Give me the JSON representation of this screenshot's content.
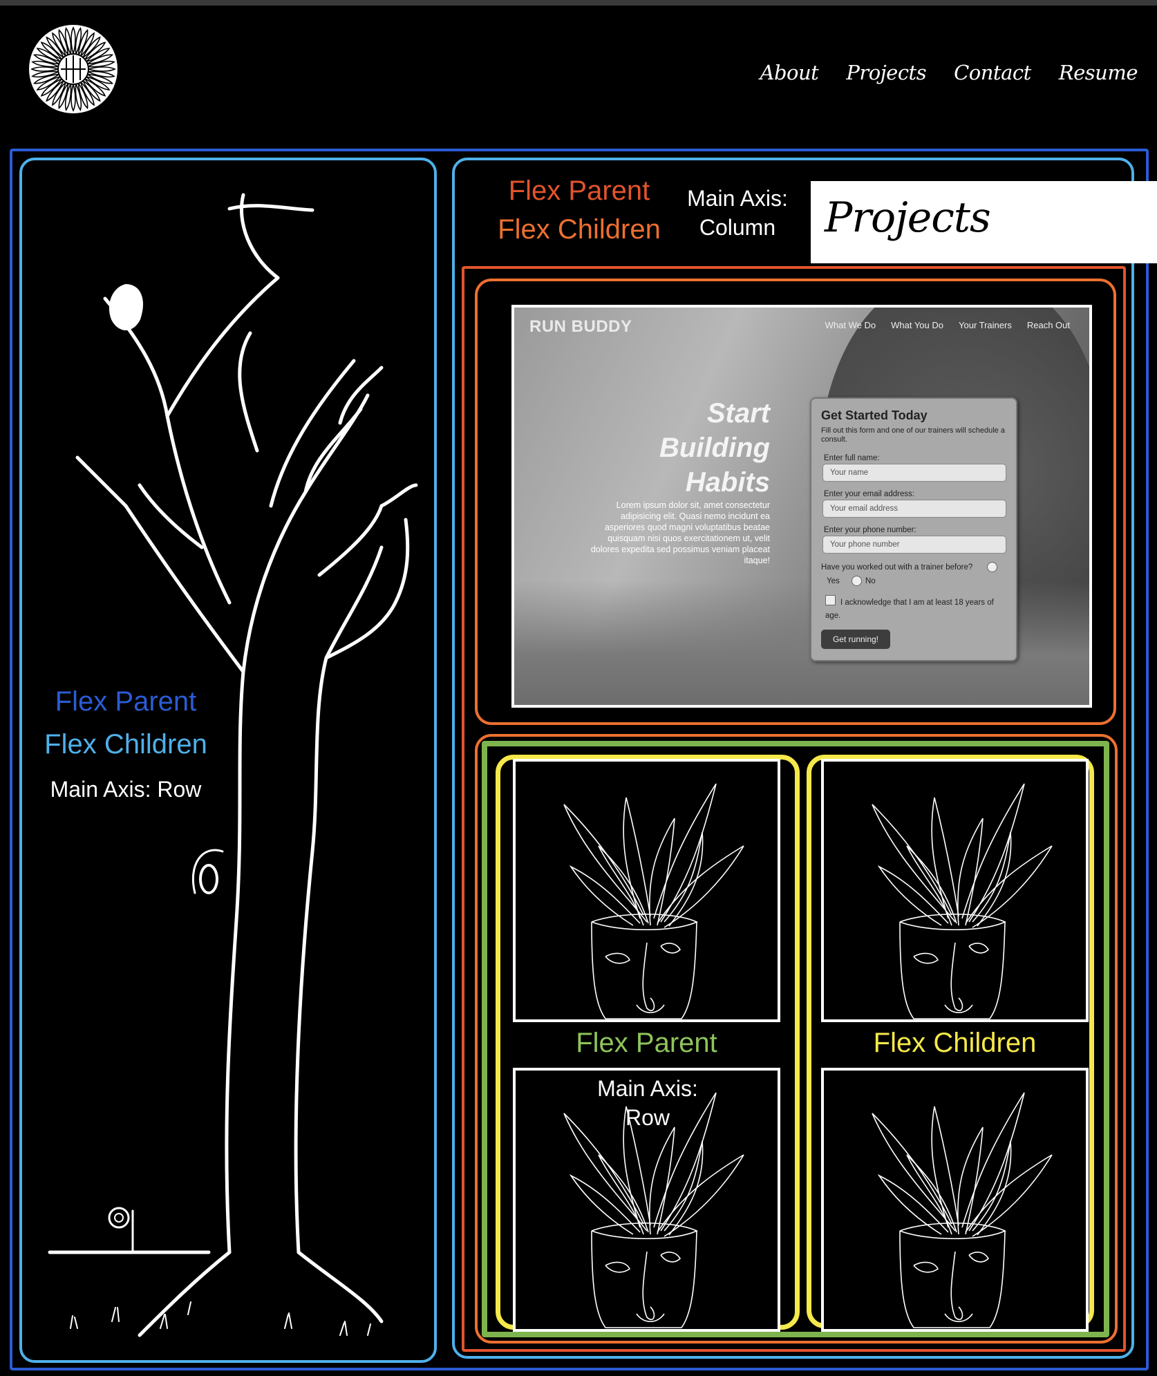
{
  "nav": {
    "items": [
      {
        "label": "About"
      },
      {
        "label": "Projects"
      },
      {
        "label": "Contact"
      },
      {
        "label": "Resume"
      }
    ]
  },
  "left_panel": {
    "label_parent": "Flex Parent",
    "label_children": "Flex Children",
    "label_axis": "Main Axis: Row"
  },
  "right_panel": {
    "label_parent": "Flex Parent",
    "label_children": "Flex Children",
    "label_axis": "Main Axis: Column",
    "projects_title": "Projects"
  },
  "run_buddy": {
    "brand": "RUN BUDDY",
    "nav": [
      "What We Do",
      "What You Do",
      "Your Trainers",
      "Reach Out"
    ],
    "hero": "Start Building Habits",
    "lorem": "Lorem ipsum dolor sit, amet consectetur adipisicing elit. Quasi nemo incidunt ea asperiores quod magni voluptatibus beatae quisquam nisi quos exercitationem ut, velit dolores expedita sed possimus veniam placeat itaque!",
    "form": {
      "title": "Get Started Today",
      "subtitle": "Fill out this form and one of our trainers will schedule a consult.",
      "name_label": "Enter full name:",
      "name_placeholder": "Your name",
      "email_label": "Enter your email address:",
      "email_placeholder": "Your email address",
      "phone_label": "Enter your phone number:",
      "phone_placeholder": "Your phone number",
      "trainer_question": "Have you worked out with a trainer before?",
      "yes": "Yes",
      "no": "No",
      "ack": "I acknowledge that I am at least 18 years of age.",
      "button": "Get running!"
    }
  },
  "grid_panel": {
    "label_parent": "Flex Parent",
    "label_children": "Flex Children",
    "label_axis": "Main Axis: Row"
  },
  "colors": {
    "blue_outer": "#2b5cd4",
    "blue_light": "#4fb0ea",
    "orange_red": "#e2542c",
    "orange": "#ec7030",
    "green": "#7eb44e",
    "yellow": "#f5e84a"
  }
}
